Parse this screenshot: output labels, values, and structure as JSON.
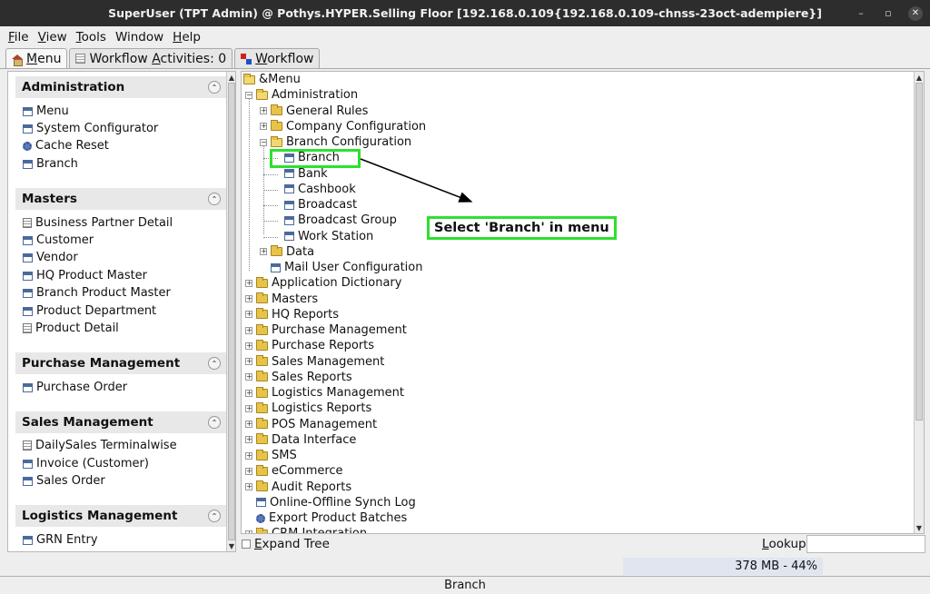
{
  "window": {
    "title": "SuperUser (TPT Admin) @ Pothys.HYPER.Selling Floor [192.168.0.109{192.168.0.109-chnss-23oct-adempiere}]",
    "min_glyph": "–",
    "max_glyph": "▫",
    "close_glyph": "✕"
  },
  "menubar": {
    "items": [
      {
        "key": "F",
        "rest": "ile"
      },
      {
        "key": "V",
        "rest": "iew"
      },
      {
        "key": "T",
        "rest": "ools"
      },
      {
        "key": "",
        "rest": "Window"
      },
      {
        "key": "H",
        "rest": "elp"
      }
    ]
  },
  "tabs": [
    {
      "key": "M",
      "rest": "enu",
      "icon": "home-icon",
      "active": true
    },
    {
      "key": "",
      "rest": "Workflow ",
      "key2": "A",
      "rest2": "ctivities: 0",
      "icon": "activities-icon",
      "active": false
    },
    {
      "key": "W",
      "rest": "orkflow",
      "icon": "workflow-icon",
      "active": false
    }
  ],
  "left_panel": {
    "sections": [
      {
        "title": "Administration",
        "items": [
          {
            "label": "Menu",
            "icon": "window-icon"
          },
          {
            "label": "System Configurator",
            "icon": "window-icon"
          },
          {
            "label": "Cache Reset",
            "icon": "process-gear-icon"
          },
          {
            "label": "Branch",
            "icon": "window-icon"
          }
        ]
      },
      {
        "title": "Masters",
        "items": [
          {
            "label": "Business Partner Detail",
            "icon": "form-icon"
          },
          {
            "label": "Customer",
            "icon": "window-icon"
          },
          {
            "label": "Vendor",
            "icon": "window-icon"
          },
          {
            "label": "HQ Product Master",
            "icon": "window-icon"
          },
          {
            "label": "Branch Product Master",
            "icon": "window-icon"
          },
          {
            "label": "Product Department",
            "icon": "window-icon"
          },
          {
            "label": "Product Detail",
            "icon": "form-icon"
          }
        ]
      },
      {
        "title": "Purchase Management",
        "items": [
          {
            "label": "Purchase Order",
            "icon": "window-icon"
          }
        ]
      },
      {
        "title": "Sales Management",
        "items": [
          {
            "label": "DailySales Terminalwise",
            "icon": "form-icon"
          },
          {
            "label": "Invoice (Customer)",
            "icon": "window-icon"
          },
          {
            "label": "Sales Order",
            "icon": "window-icon"
          }
        ]
      },
      {
        "title": "Logistics Management",
        "items": [
          {
            "label": "GRN Entry",
            "icon": "window-icon"
          }
        ]
      }
    ]
  },
  "tree": {
    "root": "&Menu",
    "nodes": [
      {
        "label": "Administration",
        "type": "folder",
        "open": true,
        "level": 1
      },
      {
        "label": "General Rules",
        "type": "folder",
        "open": false,
        "level": 2
      },
      {
        "label": "Company Configuration",
        "type": "folder",
        "open": false,
        "level": 2
      },
      {
        "label": "Branch Configuration",
        "type": "folder",
        "open": true,
        "level": 2
      },
      {
        "label": "Branch",
        "type": "window",
        "level": 3
      },
      {
        "label": "Bank",
        "type": "window",
        "level": 3
      },
      {
        "label": "Cashbook",
        "type": "window",
        "level": 3
      },
      {
        "label": "Broadcast",
        "type": "window",
        "level": 3
      },
      {
        "label": "Broadcast Group",
        "type": "window",
        "level": 3
      },
      {
        "label": "Work Station",
        "type": "window",
        "level": 3
      },
      {
        "label": "Data",
        "type": "folder",
        "open": false,
        "level": 2
      },
      {
        "label": "Mail User Configuration",
        "type": "window",
        "level": 2
      },
      {
        "label": "Application Dictionary",
        "type": "folder",
        "open": false,
        "level": 1
      },
      {
        "label": "Masters",
        "type": "folder",
        "open": false,
        "level": 1
      },
      {
        "label": "HQ Reports",
        "type": "folder",
        "open": false,
        "level": 1
      },
      {
        "label": "Purchase Management",
        "type": "folder",
        "open": false,
        "level": 1
      },
      {
        "label": "Purchase Reports",
        "type": "folder",
        "open": false,
        "level": 1
      },
      {
        "label": "Sales Management",
        "type": "folder",
        "open": false,
        "level": 1
      },
      {
        "label": "Sales Reports",
        "type": "folder",
        "open": false,
        "level": 1
      },
      {
        "label": "Logistics Management",
        "type": "folder",
        "open": false,
        "level": 1
      },
      {
        "label": "Logistics Reports",
        "type": "folder",
        "open": false,
        "level": 1
      },
      {
        "label": "POS Management",
        "type": "folder",
        "open": false,
        "level": 1
      },
      {
        "label": "Data Interface",
        "type": "folder",
        "open": false,
        "level": 1
      },
      {
        "label": "SMS",
        "type": "folder",
        "open": false,
        "level": 1
      },
      {
        "label": "eCommerce",
        "type": "folder",
        "open": false,
        "level": 1
      },
      {
        "label": "Audit Reports",
        "type": "folder",
        "open": false,
        "level": 1
      },
      {
        "label": "Online-Offline Synch Log",
        "type": "window",
        "level": 1
      },
      {
        "label": "Export Product Batches",
        "type": "process",
        "level": 1
      },
      {
        "label": "CRM Integration",
        "type": "folder",
        "open": false,
        "level": 1
      }
    ],
    "annotation": "Select 'Branch' in menu"
  },
  "bottom": {
    "expand_key": "E",
    "expand_rest": "xpand Tree",
    "lookup_key": "L",
    "lookup_rest": "ookup",
    "lookup_value": "",
    "memory": "378 MB - 44%",
    "memory_percent": 44
  },
  "status": {
    "text": "Branch"
  },
  "colors": {
    "annotation": "#2ee02e",
    "titlebar": "#2d2d2d"
  }
}
